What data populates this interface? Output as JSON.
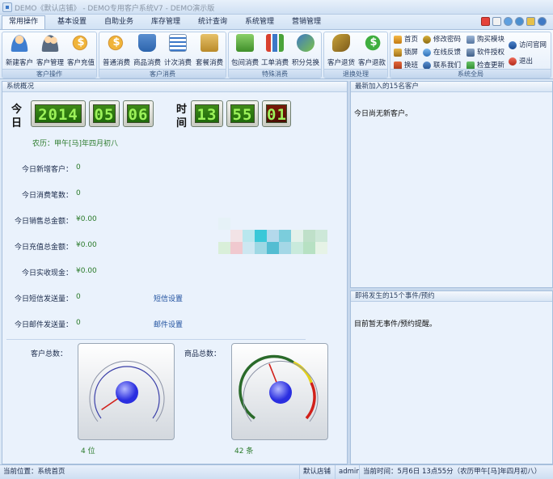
{
  "window": {
    "title": "DEMO《默认店铺》 - DEMO专用客户系统V7 - DEMO演示版"
  },
  "tabs": [
    {
      "label": "常用操作",
      "active": true
    },
    {
      "label": "基本设置"
    },
    {
      "label": "自助业务"
    },
    {
      "label": "库存管理"
    },
    {
      "label": "统计查询"
    },
    {
      "label": "系统管理"
    },
    {
      "label": "营销管理"
    }
  ],
  "ribbon": {
    "groups": [
      {
        "label": "客户操作",
        "buttons": [
          "新建客户",
          "客户管理",
          "客户充值"
        ]
      },
      {
        "label": "客户消费",
        "buttons": [
          "普通消费",
          "商品消费",
          "计次消费",
          "套餐消费"
        ]
      },
      {
        "label": "特殊消费",
        "buttons": [
          "包间消费",
          "工单消费",
          "积分兑换"
        ]
      },
      {
        "label": "退换处理",
        "buttons": [
          "客户退货",
          "客户退款"
        ]
      },
      {
        "label": "系统全局",
        "items": [
          "首页",
          "修改密码",
          "购买模块",
          "锁屏",
          "在线反馈",
          "软件授权",
          "换班",
          "联系我们",
          "检查更新",
          "访问官网",
          "退出"
        ]
      }
    ]
  },
  "overview": {
    "heading": "系统概况",
    "date_char_top": "今",
    "date_char_bottom": "日",
    "time_char_top": "时",
    "time_char_bottom": "间",
    "date_digits": [
      "2014",
      "05",
      "06"
    ],
    "time_digits": [
      "13",
      "55",
      "01"
    ],
    "lunar": "农历：甲午[马]年四月初八",
    "stats": [
      {
        "label": "今日新增客户：",
        "value": "0"
      },
      {
        "label": "今日消费笔数：",
        "value": "0"
      },
      {
        "label": "今日销售总金额：",
        "value": "¥0.00"
      },
      {
        "label": "今日充值总金额：",
        "value": "¥0.00"
      },
      {
        "label": "今日实收现金：",
        "value": "¥0.00"
      },
      {
        "label": "今日短信发送量：",
        "value": "0",
        "link": "短信设置"
      },
      {
        "label": "今日邮件发送量：",
        "value": "0",
        "link": "邮件设置"
      }
    ],
    "gauges": [
      {
        "title": "客户总数：",
        "caption": "4 位",
        "value": 4,
        "max": 100
      },
      {
        "title": "商品总数：",
        "caption": "42 条",
        "value": 42,
        "max": 100
      }
    ],
    "mosaic_colors": [
      "#e6f2f7",
      "#f2e3e6",
      "#b9e7ee",
      "#3ac8d8",
      "#b4d9ec",
      "#7bcddc",
      "#e3f1ea",
      "#bfe0c9",
      "#cde8d8",
      "#d9efd9",
      "#f0c9cf",
      "#cde7f1",
      "#9ed8e4",
      "#54bdd2",
      "#a4d7e6",
      "#c9eadc",
      "#b7e1c3",
      "#e6f3e6"
    ]
  },
  "recent_customers": {
    "heading": "最新加入的15名客户",
    "message": "今日尚无新客户。"
  },
  "upcoming_events": {
    "heading": "即将发生的15个事件/预约",
    "message": "目前暂无事件/预约提醒。"
  },
  "statusbar": {
    "location": "当前位置：系统首页",
    "store": "默认店铺",
    "user": "admin",
    "time": "当前时间：5月6日 13点55分（农历甲午[马]年四月初八）"
  }
}
